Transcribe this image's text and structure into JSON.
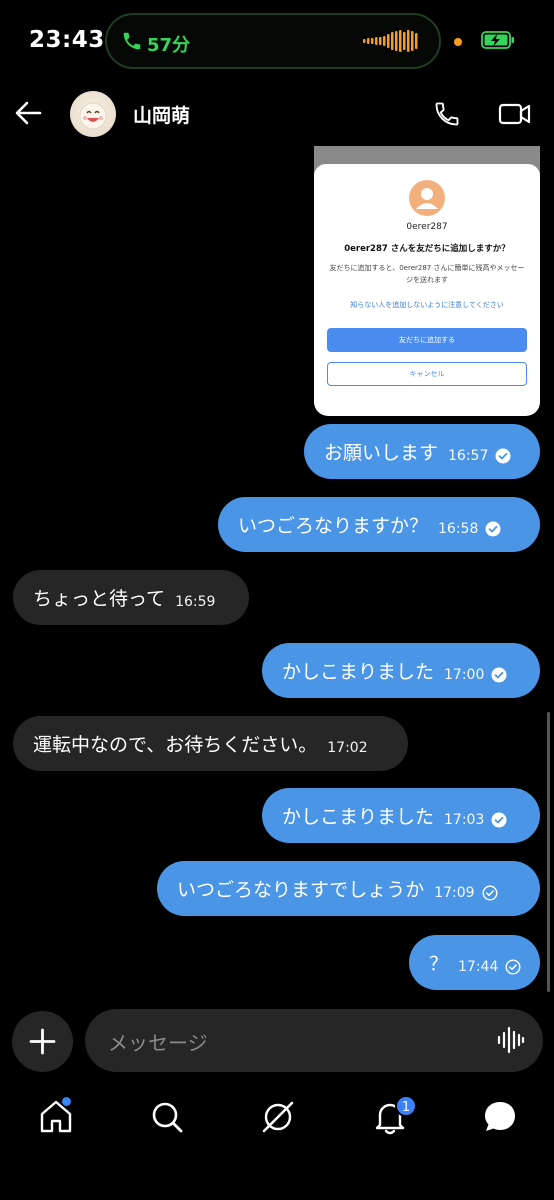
{
  "status_bar": {
    "time": "23:43",
    "call_duration": "57分",
    "call_color": "#36d45a"
  },
  "header": {
    "contact_name": "山岡萌",
    "icons": [
      "back-arrow-icon",
      "phone-icon",
      "video-camera-icon"
    ]
  },
  "shared_image": {
    "username": "0erer287",
    "title": "0erer287 さんを友だちに追加しますか？",
    "body": "友だちに追加すると、0erer287 さんに簡単に残高やメッセージを送れます",
    "warning": "知らない人を追加しないように注意してください",
    "add_button": "友だちに追加する",
    "cancel_button": "キャンセル"
  },
  "messages": [
    {
      "direction": "out",
      "text": "お願いします",
      "time": "16:57",
      "status": "read"
    },
    {
      "direction": "out",
      "text": "いつごろなりますか？",
      "time": "16:58",
      "status": "read"
    },
    {
      "direction": "in",
      "text": "ちょっと待って",
      "time": "16:59"
    },
    {
      "direction": "out",
      "text": "かしこまりました",
      "time": "17:00",
      "status": "read"
    },
    {
      "direction": "in",
      "text": "運転中なので、お待ちください。",
      "time": "17:02"
    },
    {
      "direction": "out",
      "text": "かしこまりました",
      "time": "17:03",
      "status": "read"
    },
    {
      "direction": "out",
      "text": "いつごろなりますでしょうか",
      "time": "17:09",
      "status": "sent"
    },
    {
      "direction": "out",
      "text": "？",
      "time": "17:44",
      "status": "sent"
    }
  ],
  "composer": {
    "placeholder": "メッセージ"
  },
  "bottom_nav": {
    "items": [
      "home-icon",
      "search-icon",
      "explore-icon",
      "notifications-icon",
      "chat-icon"
    ],
    "notification_count": "1",
    "accent_color": "#3b82f6"
  },
  "colors": {
    "outgoing_bubble": "#4b95e6",
    "incoming_bubble": "#262626",
    "background": "#000000"
  }
}
